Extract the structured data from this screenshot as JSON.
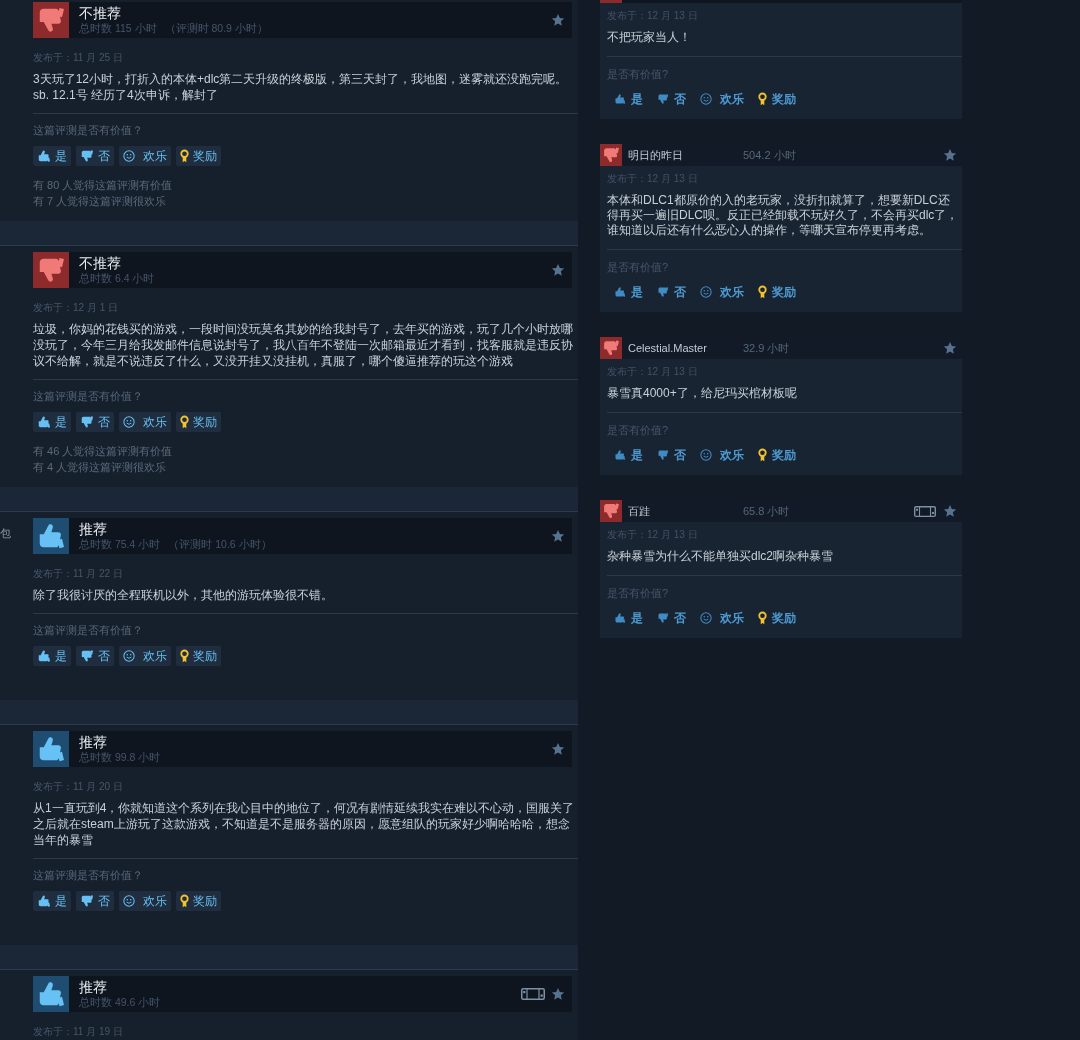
{
  "left_column": {
    "reviews": [
      {
        "recommended": false,
        "verdict": "不推荐",
        "playtime": "总时数 115 小时",
        "playtime_at_review": "（评测时 80.9 小时）",
        "on_deck": false,
        "posted": "发布于：11 月 25 日",
        "text": "3天玩了12小时，打折入的本体+dlc第二天升级的终极版，第三天封了，我地图，迷雾就还没跑完呢。sb. 12.1号 经历了4次申诉，解封了",
        "helpful_prompt": "这篇评测是否有价值？",
        "votes": [
          {
            "kind": "yes",
            "label": "是"
          },
          {
            "kind": "no",
            "label": "否"
          },
          {
            "kind": "funny",
            "label": "欢乐"
          },
          {
            "kind": "award",
            "label": "奖励"
          }
        ],
        "stats": [
          "有 80 人觉得这篇评测有价值",
          "有 7 人觉得这篇评测很欢乐"
        ]
      },
      {
        "recommended": false,
        "verdict": "不推荐",
        "playtime": "总时数 6.4 小时",
        "on_deck": false,
        "posted": "发布于：12 月 1 日",
        "text": "垃圾，你妈的花钱买的游戏，一段时间没玩莫名其妙的给我封号了，去年买的游戏，玩了几个小时放哪没玩了，今年三月给我发邮件信息说封号了，我八百年不登陆一次邮箱最近才看到，找客服就是违反协议不给解，就是不说违反了什么，又没开挂又没挂机，真服了，哪个傻逼推荐的玩这个游戏",
        "helpful_prompt": "这篇评测是否有价值？",
        "votes": [
          {
            "kind": "yes",
            "label": "是"
          },
          {
            "kind": "no",
            "label": "否"
          },
          {
            "kind": "funny",
            "label": "欢乐"
          },
          {
            "kind": "award",
            "label": "奖励"
          }
        ],
        "stats": [
          "有 46 人觉得这篇评测有价值",
          "有 4 人觉得这篇评测很欢乐"
        ]
      },
      {
        "edge_text": "包",
        "recommended": true,
        "verdict": "推荐",
        "playtime": "总时数 75.4 小时",
        "playtime_at_review": "（评测时 10.6 小时）",
        "on_deck": false,
        "posted": "发布于：11 月 22 日",
        "text": "除了我很讨厌的全程联机以外，其他的游玩体验很不错。",
        "helpful_prompt": "这篇评测是否有价值？",
        "votes": [
          {
            "kind": "yes",
            "label": "是"
          },
          {
            "kind": "no",
            "label": "否"
          },
          {
            "kind": "funny",
            "label": "欢乐"
          },
          {
            "kind": "award",
            "label": "奖励"
          }
        ]
      },
      {
        "recommended": true,
        "verdict": "推荐",
        "playtime": "总时数 99.8 小时",
        "on_deck": false,
        "posted": "发布于：11 月 20 日",
        "text": "从1一直玩到4，你就知道这个系列在我心目中的地位了，何况有剧情延续我实在难以不心动，国服关了之后就在steam上游玩了这款游戏，不知道是不是服务器的原因，愿意组队的玩家好少啊哈哈哈，想念当年的暴雪",
        "helpful_prompt": "这篇评测是否有价值？",
        "votes": [
          {
            "kind": "yes",
            "label": "是"
          },
          {
            "kind": "no",
            "label": "否"
          },
          {
            "kind": "funny",
            "label": "欢乐"
          },
          {
            "kind": "award",
            "label": "奖励"
          }
        ]
      },
      {
        "recommended": true,
        "verdict": "推荐",
        "playtime": "总时数 49.6 小时",
        "on_deck": true,
        "posted": "发布于：11 月 19 日"
      }
    ]
  },
  "right_column": {
    "reviews": [
      {
        "recommended": false,
        "posted": "发布于：12 月 13 日",
        "text": "不把玩家当人！",
        "helpful_prompt": "是否有价值?",
        "votes": [
          {
            "kind": "yes",
            "label": "是"
          },
          {
            "kind": "no",
            "label": "否"
          },
          {
            "kind": "funny",
            "label": "欢乐"
          },
          {
            "kind": "award",
            "label": "奖励"
          }
        ]
      },
      {
        "recommended": false,
        "author": "明日的昨日",
        "hours": "504.2 小时",
        "on_deck": false,
        "posted": "发布于：12 月 13 日",
        "text": "本体和DLC1都原价的入的老玩家，没折扣就算了，想要新DLC还得再买一遍旧DLC呗。反正已经卸载不玩好久了，不会再买dlc了，谁知道以后还有什么恶心人的操作，等哪天宣布停更再考虑。",
        "helpful_prompt": "是否有价值?",
        "votes": [
          {
            "kind": "yes",
            "label": "是"
          },
          {
            "kind": "no",
            "label": "否"
          },
          {
            "kind": "funny",
            "label": "欢乐"
          },
          {
            "kind": "award",
            "label": "奖励"
          }
        ]
      },
      {
        "recommended": false,
        "author": "Celestial.Master",
        "hours": "32.9 小时",
        "on_deck": false,
        "posted": "发布于：12 月 13 日",
        "text": "暴雪真4000+了，给尼玛买棺材板呢",
        "helpful_prompt": "是否有价值?",
        "votes": [
          {
            "kind": "yes",
            "label": "是"
          },
          {
            "kind": "no",
            "label": "否"
          },
          {
            "kind": "funny",
            "label": "欢乐"
          },
          {
            "kind": "award",
            "label": "奖励"
          }
        ]
      },
      {
        "recommended": false,
        "author": "百跬",
        "hours": "65.8 小时",
        "on_deck": true,
        "posted": "发布于：12 月 13 日",
        "text": "杂种暴雪为什么不能单独买dlc2啊杂种暴雪",
        "helpful_prompt": "是否有价值?",
        "votes": [
          {
            "kind": "yes",
            "label": "是"
          },
          {
            "kind": "no",
            "label": "否"
          },
          {
            "kind": "funny",
            "label": "欢乐"
          },
          {
            "kind": "award",
            "label": "奖励"
          }
        ]
      }
    ]
  }
}
